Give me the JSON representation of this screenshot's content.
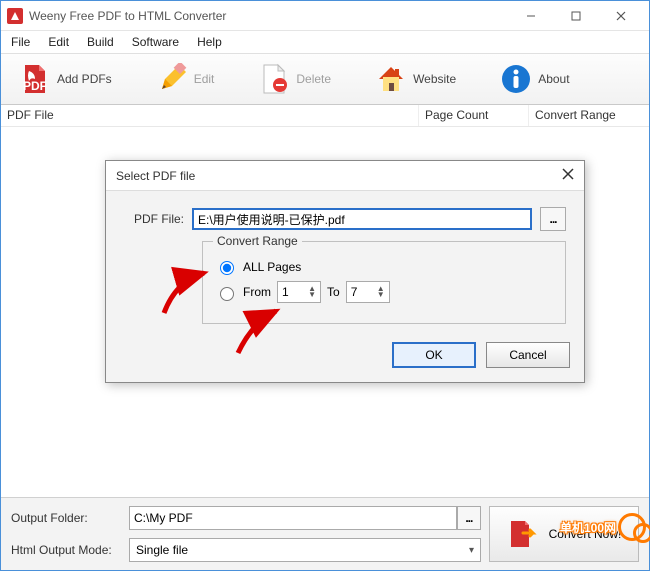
{
  "title": "Weeny Free PDF to HTML Converter",
  "menus": {
    "file": "File",
    "edit": "Edit",
    "build": "Build",
    "software": "Software",
    "help": "Help"
  },
  "toolbar": {
    "add": "Add PDFs",
    "edit": "Edit",
    "delete": "Delete",
    "website": "Website",
    "about": "About"
  },
  "columns": {
    "pdf": "PDF File",
    "count": "Page Count",
    "range": "Convert Range"
  },
  "bottom": {
    "output_label": "Output Folder:",
    "output_value": "C:\\My PDF",
    "mode_label": "Html Output Mode:",
    "mode_value": "Single file",
    "convert": "Convert Now!",
    "browse_dots": "..."
  },
  "dialog": {
    "title": "Select PDF file",
    "file_label": "PDF File:",
    "file_value": "E:\\用户使用说明-已保护.pdf",
    "browse_dots": "...",
    "range_legend": "Convert Range",
    "all_label": "ALL Pages",
    "from_label": "From",
    "to_label": "To",
    "from_value": "1",
    "to_value": "7",
    "ok": "OK",
    "cancel": "Cancel"
  },
  "watermark": "单机100网"
}
